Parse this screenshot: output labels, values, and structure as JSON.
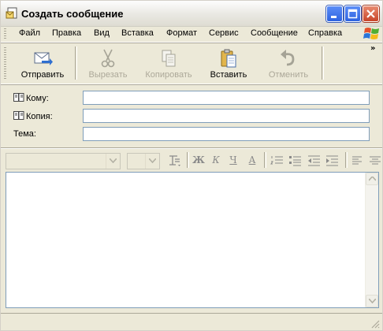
{
  "window": {
    "title": "Создать сообщение"
  },
  "menu": {
    "items": [
      "Файл",
      "Правка",
      "Вид",
      "Вставка",
      "Формат",
      "Сервис",
      "Сообщение",
      "Справка"
    ]
  },
  "toolbar": {
    "send": "Отправить",
    "cut": "Вырезать",
    "copy": "Копировать",
    "paste": "Вставить",
    "undo": "Отменить",
    "overflow": "»"
  },
  "fields": {
    "to": {
      "label": "Кому:",
      "value": ""
    },
    "cc": {
      "label": "Копия:",
      "value": ""
    },
    "subject": {
      "label": "Тема:",
      "value": ""
    }
  },
  "format": {
    "font_name": "",
    "font_size": "",
    "icons": [
      "paragraph-style-icon",
      "bold-icon",
      "italic-icon",
      "underline-icon",
      "font-color-icon",
      "numbered-list-icon",
      "bulleted-list-icon",
      "decrease-indent-icon",
      "increase-indent-icon",
      "align-left-icon",
      "align-center-icon"
    ],
    "bold": "Ж",
    "italic": "К",
    "underline": "Ч",
    "color": "A"
  },
  "body": {
    "text": ""
  },
  "colors": {
    "title_close": "#c8452a",
    "title_buttons": "#2d63e0",
    "input_border": "#7f9db9"
  }
}
